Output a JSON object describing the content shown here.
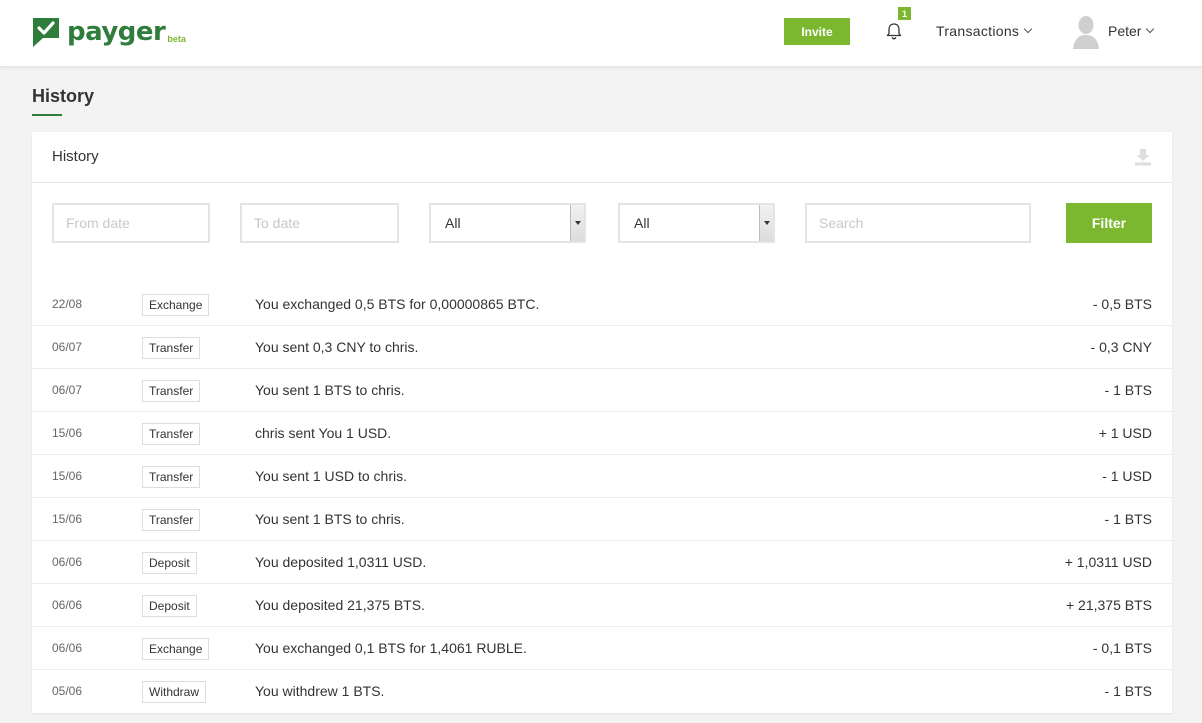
{
  "header": {
    "brand": "payger",
    "brand_tag": "beta",
    "invite_label": "Invite",
    "notification_count": "1",
    "transactions_label": "Transactions",
    "user_name": "Peter"
  },
  "page": {
    "title": "History"
  },
  "card": {
    "title": "History"
  },
  "filters": {
    "from_date_placeholder": "From date",
    "to_date_placeholder": "To date",
    "type_selected": "All",
    "currency_selected": "All",
    "search_placeholder": "Search",
    "filter_label": "Filter"
  },
  "transactions": [
    {
      "date": "22/08",
      "type": "Exchange",
      "description": "You exchanged 0,5 BTS for 0,00000865 BTC.",
      "amount": "- 0,5 BTS"
    },
    {
      "date": "06/07",
      "type": "Transfer",
      "description": "You sent 0,3 CNY to chris.",
      "amount": "- 0,3 CNY"
    },
    {
      "date": "06/07",
      "type": "Transfer",
      "description": "You sent 1 BTS to chris.",
      "amount": "- 1 BTS"
    },
    {
      "date": "15/06",
      "type": "Transfer",
      "description": "chris sent You 1 USD.",
      "amount": "+ 1 USD"
    },
    {
      "date": "15/06",
      "type": "Transfer",
      "description": "You sent 1 USD to chris.",
      "amount": "- 1 USD"
    },
    {
      "date": "15/06",
      "type": "Transfer",
      "description": "You sent 1 BTS to chris.",
      "amount": "- 1 BTS"
    },
    {
      "date": "06/06",
      "type": "Deposit",
      "description": "You deposited 1,0311 USD.",
      "amount": "+ 1,0311 USD"
    },
    {
      "date": "06/06",
      "type": "Deposit",
      "description": "You deposited 21,375 BTS.",
      "amount": "+ 21,375 BTS"
    },
    {
      "date": "06/06",
      "type": "Exchange",
      "description": "You exchanged 0,1 BTS for 1,4061 RUBLE.",
      "amount": "- 0,1 BTS"
    },
    {
      "date": "05/06",
      "type": "Withdraw",
      "description": "You withdrew 1 BTS.",
      "amount": "- 1 BTS"
    }
  ],
  "colors": {
    "brand_green": "#2e7d3a",
    "accent_green": "#7cb82f"
  },
  "icons": {
    "logo": "payger-logo-icon",
    "bell": "bell-icon",
    "avatar": "user-avatar-icon",
    "download": "download-icon"
  }
}
